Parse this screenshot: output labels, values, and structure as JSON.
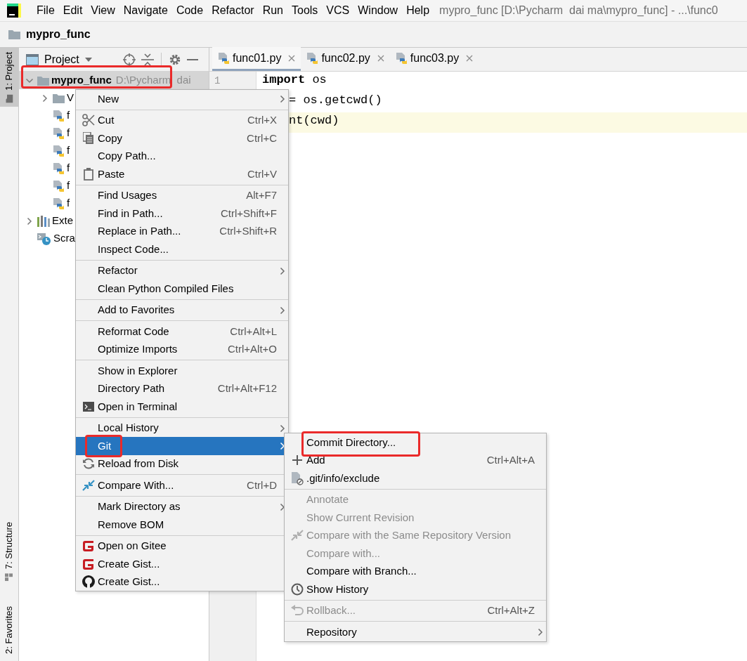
{
  "window": {
    "title": "mypro_func [D:\\Pycharm  dai ma\\mypro_func] - ...\\func0"
  },
  "menu_bar": [
    "File",
    "Edit",
    "View",
    "Navigate",
    "Code",
    "Refactor",
    "Run",
    "Tools",
    "VCS",
    "Window",
    "Help"
  ],
  "breadcrumb": "mypro_func",
  "tool_strip": {
    "top": [
      {
        "label": "1: Project",
        "selected": true
      }
    ],
    "bottom": [
      {
        "label": "7: Structure",
        "selected": false
      },
      {
        "label": "2: Favorites",
        "selected": false
      }
    ]
  },
  "project_panel": {
    "title": "Project",
    "tree": [
      {
        "label": "mypro_func",
        "path": "D:\\Pycharm  dai",
        "kind": "root",
        "expanded": true,
        "selected": true,
        "highlighted": true,
        "children": [
          {
            "label": "V",
            "kind": "folder",
            "expanded": false,
            "selected": false
          },
          {
            "label": "f",
            "kind": "python",
            "selected": false
          },
          {
            "label": "f",
            "kind": "python",
            "selected": false
          },
          {
            "label": "f",
            "kind": "python",
            "selected": false
          },
          {
            "label": "f",
            "kind": "python",
            "selected": false
          },
          {
            "label": "f",
            "kind": "python",
            "selected": false
          },
          {
            "label": "f",
            "kind": "python",
            "selected": false
          }
        ]
      },
      {
        "label": "Exte",
        "kind": "library",
        "expanded": false,
        "selected": false
      },
      {
        "label": "Scra",
        "kind": "scratch",
        "selected": false
      }
    ]
  },
  "editor": {
    "tabs": [
      {
        "label": "func01.py",
        "selected": true
      },
      {
        "label": "func02.py",
        "selected": false
      },
      {
        "label": "func03.py",
        "selected": false
      }
    ],
    "line_numbers": [
      "1"
    ],
    "lines": [
      {
        "text": "**import** os",
        "current": false
      },
      {
        "text": "= os.getcwd()",
        "current": false
      },
      {
        "text": "nt(cwd)",
        "current": true
      }
    ]
  },
  "context_menu": {
    "items": [
      {
        "kind": "item",
        "label": "New",
        "submenu": true,
        "selected": false
      },
      {
        "kind": "separator"
      },
      {
        "kind": "item",
        "label": "Cut",
        "shortcut": "Ctrl+X",
        "selected": false
      },
      {
        "kind": "item",
        "label": "Copy",
        "shortcut": "Ctrl+C",
        "selected": false
      },
      {
        "kind": "item",
        "label": "Copy Path...",
        "selected": false
      },
      {
        "kind": "item",
        "label": "Paste",
        "shortcut": "Ctrl+V",
        "selected": false
      },
      {
        "kind": "separator"
      },
      {
        "kind": "item",
        "label": "Find Usages",
        "shortcut": "Alt+F7",
        "selected": false
      },
      {
        "kind": "item",
        "label": "Find in Path...",
        "shortcut": "Ctrl+Shift+F",
        "selected": false
      },
      {
        "kind": "item",
        "label": "Replace in Path...",
        "shortcut": "Ctrl+Shift+R",
        "selected": false
      },
      {
        "kind": "item",
        "label": "Inspect Code...",
        "selected": false
      },
      {
        "kind": "separator"
      },
      {
        "kind": "item",
        "label": "Refactor",
        "submenu": true,
        "selected": false
      },
      {
        "kind": "item",
        "label": "Clean Python Compiled Files",
        "selected": false
      },
      {
        "kind": "separator"
      },
      {
        "kind": "item",
        "label": "Add to Favorites",
        "submenu": true,
        "selected": false
      },
      {
        "kind": "separator"
      },
      {
        "kind": "item",
        "label": "Reformat Code",
        "shortcut": "Ctrl+Alt+L",
        "selected": false
      },
      {
        "kind": "item",
        "label": "Optimize Imports",
        "shortcut": "Ctrl+Alt+O",
        "selected": false
      },
      {
        "kind": "separator"
      },
      {
        "kind": "item",
        "label": "Show in Explorer",
        "selected": false
      },
      {
        "kind": "item",
        "label": "Directory Path",
        "shortcut": "Ctrl+Alt+F12",
        "selected": false
      },
      {
        "kind": "item",
        "label": "Open in Terminal",
        "selected": false
      },
      {
        "kind": "separator"
      },
      {
        "kind": "item",
        "label": "Local History",
        "submenu": true,
        "selected": false
      },
      {
        "kind": "item",
        "label": "Git",
        "submenu": true,
        "selected": true,
        "highlighted": true
      },
      {
        "kind": "item",
        "label": "Reload from Disk",
        "selected": false
      },
      {
        "kind": "separator"
      },
      {
        "kind": "item",
        "label": "Compare With...",
        "shortcut": "Ctrl+D",
        "selected": false
      },
      {
        "kind": "separator"
      },
      {
        "kind": "item",
        "label": "Mark Directory as",
        "submenu": true,
        "selected": false
      },
      {
        "kind": "item",
        "label": "Remove BOM",
        "selected": false
      },
      {
        "kind": "separator"
      },
      {
        "kind": "item",
        "label": "Open on Gitee",
        "selected": false
      },
      {
        "kind": "item",
        "label": "Create Gist...",
        "selected": false
      },
      {
        "kind": "item",
        "label": "Create Gist...",
        "selected": false
      }
    ]
  },
  "git_submenu": {
    "items": [
      {
        "kind": "item",
        "label": "Commit Directory...",
        "disabled": false,
        "selected": false,
        "highlighted": true
      },
      {
        "kind": "item",
        "label": "Add",
        "shortcut": "Ctrl+Alt+A",
        "disabled": false,
        "selected": false
      },
      {
        "kind": "item",
        "label": ".git/info/exclude",
        "disabled": false,
        "selected": false
      },
      {
        "kind": "separator"
      },
      {
        "kind": "item",
        "label": "Annotate",
        "disabled": true,
        "selected": false
      },
      {
        "kind": "item",
        "label": "Show Current Revision",
        "disabled": true,
        "selected": false
      },
      {
        "kind": "item",
        "label": "Compare with the Same Repository Version",
        "disabled": true,
        "selected": false
      },
      {
        "kind": "item",
        "label": "Compare with...",
        "disabled": true,
        "selected": false
      },
      {
        "kind": "item",
        "label": "Compare with Branch...",
        "disabled": false,
        "selected": false
      },
      {
        "kind": "item",
        "label": "Show History",
        "disabled": false,
        "selected": false
      },
      {
        "kind": "separator"
      },
      {
        "kind": "item",
        "label": "Rollback...",
        "shortcut": "Ctrl+Alt+Z",
        "disabled": true,
        "selected": false
      },
      {
        "kind": "separator"
      },
      {
        "kind": "item",
        "label": "Repository",
        "submenu": true,
        "disabled": false,
        "selected": false
      }
    ]
  }
}
